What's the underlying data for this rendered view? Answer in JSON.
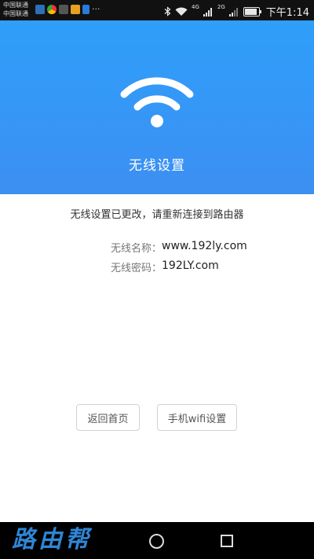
{
  "status_bar": {
    "carrier_1": "中国联通",
    "carrier_2": "中国联通",
    "notification_more": "···",
    "network_1": "4G",
    "network_2": "2G",
    "time": "下午1:14"
  },
  "header": {
    "title": "无线设置",
    "icon": "wifi-icon",
    "background_color": "#3a95f5"
  },
  "main": {
    "message": "无线设置已更改，请重新连接到路由器",
    "ssid_label": "无线名称：",
    "ssid_value": "www.192ly.com",
    "password_label": "无线密码：",
    "password_value": "192LY.com"
  },
  "buttons": {
    "back_home": "返回首页",
    "phone_wifi_settings": "手机wifi设置"
  },
  "nav_bar": {
    "watermark": "路由帮",
    "home_icon": "circle-home-icon",
    "recent_icon": "square-recent-icon"
  }
}
